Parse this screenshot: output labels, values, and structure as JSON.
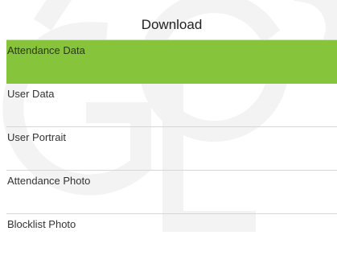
{
  "header": {
    "title": "Download"
  },
  "menu": {
    "selected_index": 0,
    "items": [
      {
        "label": "Attendance Data"
      },
      {
        "label": "User Data"
      },
      {
        "label": "User Portrait"
      },
      {
        "label": "Attendance Photo"
      },
      {
        "label": "Blocklist Photo"
      }
    ]
  },
  "colors": {
    "selected_background": "#86c43b",
    "divider": "#d6d6d6",
    "text": "#333333",
    "watermark": "#f2f2f2"
  }
}
